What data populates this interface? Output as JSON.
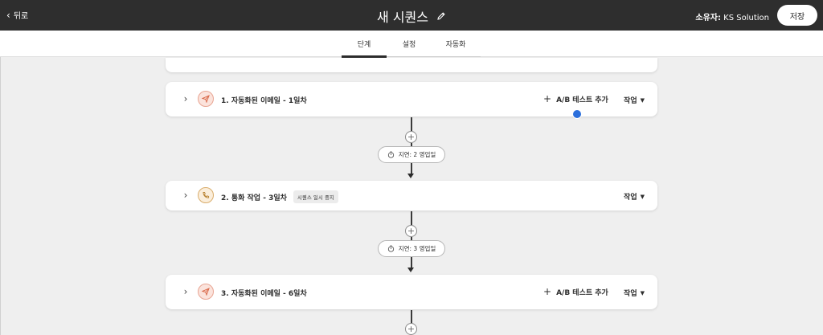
{
  "header": {
    "back_label": "뒤로",
    "title": "새 시퀀스",
    "owner_label": "소유자:",
    "owner_name": "KS Solution",
    "save_label": "저장"
  },
  "tabs": [
    {
      "label": "단계",
      "active": true
    },
    {
      "label": "설정",
      "active": false
    },
    {
      "label": "자동화",
      "active": false
    }
  ],
  "steps": [
    {
      "label": "1. 자동화된 이메일 - 1일차",
      "type": "email",
      "ab_label": "A/B 테스트 추가",
      "action_label": "작업"
    },
    {
      "label": "2. 통화 작업 - 3일차",
      "type": "call",
      "badge": "시퀀스 일시 중지",
      "action_label": "작업"
    },
    {
      "label": "3. 자동화된 이메일 - 6일차",
      "type": "email",
      "ab_label": "A/B 테스트 추가",
      "action_label": "작업"
    }
  ],
  "delays": [
    {
      "label": "지연: 2 영업일"
    },
    {
      "label": "지연: 3 영업일"
    }
  ],
  "colors": {
    "topbar": "#2e2e2e",
    "email_icon": "#d9694a",
    "call_icon": "#b98434",
    "cursor": "#2b6fdc"
  }
}
